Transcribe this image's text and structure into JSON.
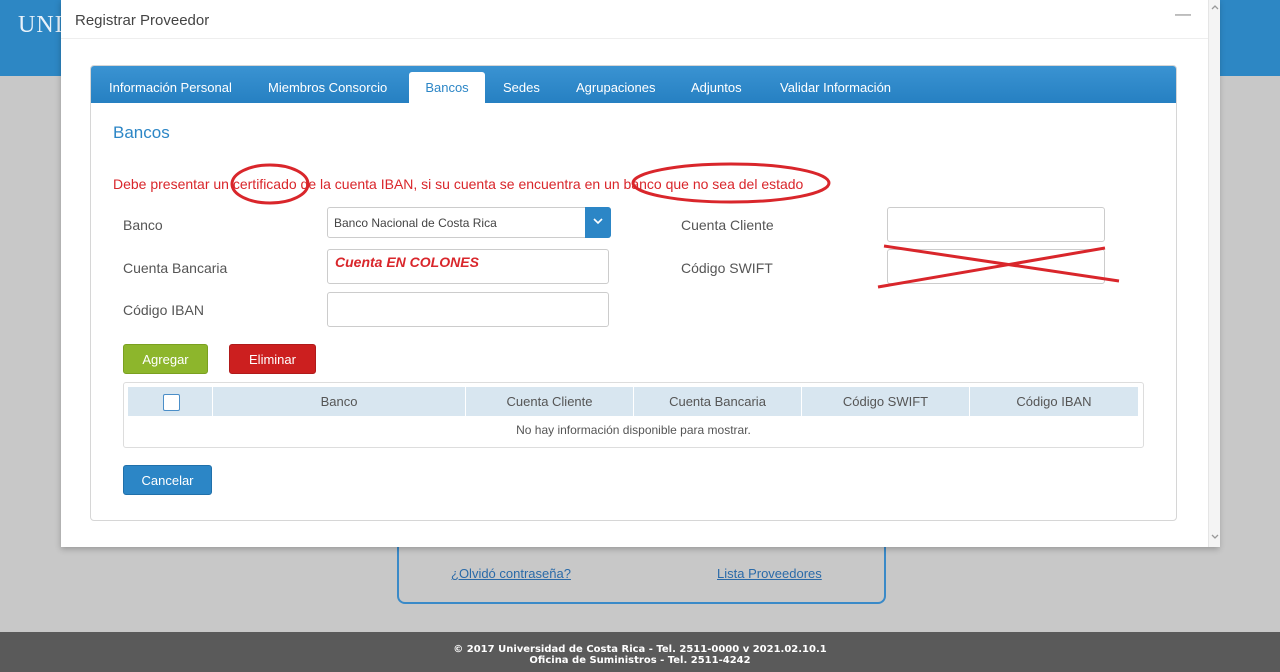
{
  "background": {
    "logo_text": "UNIV",
    "links": {
      "forgot_password": "¿Olvidó contraseña?",
      "provider_list": "Lista Proveedores"
    },
    "footer": {
      "line1": "© 2017 Universidad de Costa Rica - Tel. 2511-0000 v 2021.02.10.1",
      "line2": "Oficina de Suministros - Tel. 2511-4242"
    }
  },
  "modal": {
    "title": "Registrar Proveedor",
    "minimize_icon": "—",
    "tabs": [
      {
        "label": "Información Personal"
      },
      {
        "label": "Miembros Consorcio"
      },
      {
        "label": "Bancos",
        "active": true
      },
      {
        "label": "Sedes"
      },
      {
        "label": "Agrupaciones"
      },
      {
        "label": "Adjuntos"
      },
      {
        "label": "Validar Información"
      }
    ],
    "section_title": "Bancos",
    "warning": "Debe presentar un certificado de la cuenta IBAN, si su cuenta se encuentra en un banco que no sea del estado",
    "form": {
      "banco_label": "Banco",
      "banco_value": "Banco Nacional de Costa Rica",
      "cuenta_bancaria_label": "Cuenta Bancaria",
      "cuenta_bancaria_value": "",
      "codigo_iban_label": "Código IBAN",
      "codigo_iban_value": "",
      "cuenta_cliente_label": "Cuenta Cliente",
      "cuenta_cliente_value": "",
      "codigo_swift_label": "Código SWIFT",
      "codigo_swift_value": ""
    },
    "buttons": {
      "add": "Agregar",
      "delete": "Eliminar",
      "cancel": "Cancelar"
    },
    "table": {
      "columns": [
        "Banco",
        "Cuenta Cliente",
        "Cuenta Bancaria",
        "Código SWIFT",
        "Código IBAN"
      ],
      "empty_message": "No hay información disponible para mostrar."
    },
    "annotations": {
      "cuenta_note": "Cuenta EN COLONES",
      "color": "#d9262b"
    }
  },
  "colors": {
    "primary": "#2c86c6",
    "success": "#8db62c",
    "danger": "#cc1f1f",
    "warning_text": "#d9262b"
  }
}
